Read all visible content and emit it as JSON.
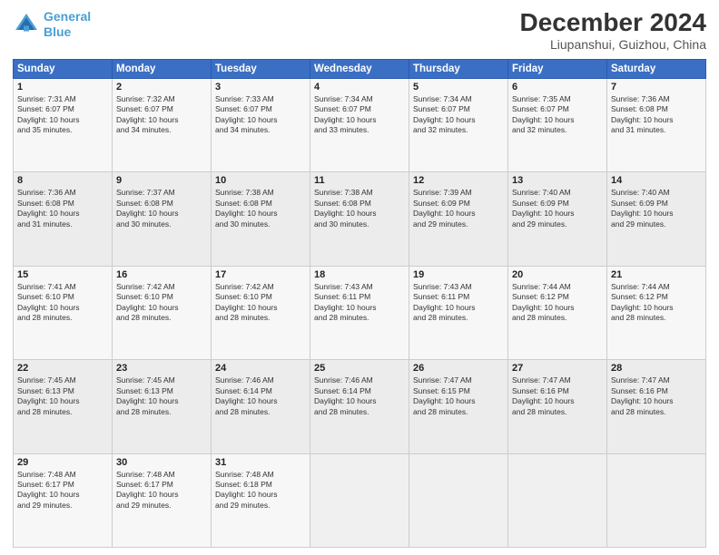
{
  "header": {
    "logo_line1": "General",
    "logo_line2": "Blue",
    "title": "December 2024",
    "subtitle": "Liupanshui, Guizhou, China"
  },
  "weekdays": [
    "Sunday",
    "Monday",
    "Tuesday",
    "Wednesday",
    "Thursday",
    "Friday",
    "Saturday"
  ],
  "weeks": [
    [
      {
        "day": "1",
        "lines": [
          "Sunrise: 7:31 AM",
          "Sunset: 6:07 PM",
          "Daylight: 10 hours",
          "and 35 minutes."
        ]
      },
      {
        "day": "2",
        "lines": [
          "Sunrise: 7:32 AM",
          "Sunset: 6:07 PM",
          "Daylight: 10 hours",
          "and 34 minutes."
        ]
      },
      {
        "day": "3",
        "lines": [
          "Sunrise: 7:33 AM",
          "Sunset: 6:07 PM",
          "Daylight: 10 hours",
          "and 34 minutes."
        ]
      },
      {
        "day": "4",
        "lines": [
          "Sunrise: 7:34 AM",
          "Sunset: 6:07 PM",
          "Daylight: 10 hours",
          "and 33 minutes."
        ]
      },
      {
        "day": "5",
        "lines": [
          "Sunrise: 7:34 AM",
          "Sunset: 6:07 PM",
          "Daylight: 10 hours",
          "and 32 minutes."
        ]
      },
      {
        "day": "6",
        "lines": [
          "Sunrise: 7:35 AM",
          "Sunset: 6:07 PM",
          "Daylight: 10 hours",
          "and 32 minutes."
        ]
      },
      {
        "day": "7",
        "lines": [
          "Sunrise: 7:36 AM",
          "Sunset: 6:08 PM",
          "Daylight: 10 hours",
          "and 31 minutes."
        ]
      }
    ],
    [
      {
        "day": "8",
        "lines": [
          "Sunrise: 7:36 AM",
          "Sunset: 6:08 PM",
          "Daylight: 10 hours",
          "and 31 minutes."
        ]
      },
      {
        "day": "9",
        "lines": [
          "Sunrise: 7:37 AM",
          "Sunset: 6:08 PM",
          "Daylight: 10 hours",
          "and 30 minutes."
        ]
      },
      {
        "day": "10",
        "lines": [
          "Sunrise: 7:38 AM",
          "Sunset: 6:08 PM",
          "Daylight: 10 hours",
          "and 30 minutes."
        ]
      },
      {
        "day": "11",
        "lines": [
          "Sunrise: 7:38 AM",
          "Sunset: 6:08 PM",
          "Daylight: 10 hours",
          "and 30 minutes."
        ]
      },
      {
        "day": "12",
        "lines": [
          "Sunrise: 7:39 AM",
          "Sunset: 6:09 PM",
          "Daylight: 10 hours",
          "and 29 minutes."
        ]
      },
      {
        "day": "13",
        "lines": [
          "Sunrise: 7:40 AM",
          "Sunset: 6:09 PM",
          "Daylight: 10 hours",
          "and 29 minutes."
        ]
      },
      {
        "day": "14",
        "lines": [
          "Sunrise: 7:40 AM",
          "Sunset: 6:09 PM",
          "Daylight: 10 hours",
          "and 29 minutes."
        ]
      }
    ],
    [
      {
        "day": "15",
        "lines": [
          "Sunrise: 7:41 AM",
          "Sunset: 6:10 PM",
          "Daylight: 10 hours",
          "and 28 minutes."
        ]
      },
      {
        "day": "16",
        "lines": [
          "Sunrise: 7:42 AM",
          "Sunset: 6:10 PM",
          "Daylight: 10 hours",
          "and 28 minutes."
        ]
      },
      {
        "day": "17",
        "lines": [
          "Sunrise: 7:42 AM",
          "Sunset: 6:10 PM",
          "Daylight: 10 hours",
          "and 28 minutes."
        ]
      },
      {
        "day": "18",
        "lines": [
          "Sunrise: 7:43 AM",
          "Sunset: 6:11 PM",
          "Daylight: 10 hours",
          "and 28 minutes."
        ]
      },
      {
        "day": "19",
        "lines": [
          "Sunrise: 7:43 AM",
          "Sunset: 6:11 PM",
          "Daylight: 10 hours",
          "and 28 minutes."
        ]
      },
      {
        "day": "20",
        "lines": [
          "Sunrise: 7:44 AM",
          "Sunset: 6:12 PM",
          "Daylight: 10 hours",
          "and 28 minutes."
        ]
      },
      {
        "day": "21",
        "lines": [
          "Sunrise: 7:44 AM",
          "Sunset: 6:12 PM",
          "Daylight: 10 hours",
          "and 28 minutes."
        ]
      }
    ],
    [
      {
        "day": "22",
        "lines": [
          "Sunrise: 7:45 AM",
          "Sunset: 6:13 PM",
          "Daylight: 10 hours",
          "and 28 minutes."
        ]
      },
      {
        "day": "23",
        "lines": [
          "Sunrise: 7:45 AM",
          "Sunset: 6:13 PM",
          "Daylight: 10 hours",
          "and 28 minutes."
        ]
      },
      {
        "day": "24",
        "lines": [
          "Sunrise: 7:46 AM",
          "Sunset: 6:14 PM",
          "Daylight: 10 hours",
          "and 28 minutes."
        ]
      },
      {
        "day": "25",
        "lines": [
          "Sunrise: 7:46 AM",
          "Sunset: 6:14 PM",
          "Daylight: 10 hours",
          "and 28 minutes."
        ]
      },
      {
        "day": "26",
        "lines": [
          "Sunrise: 7:47 AM",
          "Sunset: 6:15 PM",
          "Daylight: 10 hours",
          "and 28 minutes."
        ]
      },
      {
        "day": "27",
        "lines": [
          "Sunrise: 7:47 AM",
          "Sunset: 6:16 PM",
          "Daylight: 10 hours",
          "and 28 minutes."
        ]
      },
      {
        "day": "28",
        "lines": [
          "Sunrise: 7:47 AM",
          "Sunset: 6:16 PM",
          "Daylight: 10 hours",
          "and 28 minutes."
        ]
      }
    ],
    [
      {
        "day": "29",
        "lines": [
          "Sunrise: 7:48 AM",
          "Sunset: 6:17 PM",
          "Daylight: 10 hours",
          "and 29 minutes."
        ]
      },
      {
        "day": "30",
        "lines": [
          "Sunrise: 7:48 AM",
          "Sunset: 6:17 PM",
          "Daylight: 10 hours",
          "and 29 minutes."
        ]
      },
      {
        "day": "31",
        "lines": [
          "Sunrise: 7:48 AM",
          "Sunset: 6:18 PM",
          "Daylight: 10 hours",
          "and 29 minutes."
        ]
      },
      {
        "day": "",
        "lines": []
      },
      {
        "day": "",
        "lines": []
      },
      {
        "day": "",
        "lines": []
      },
      {
        "day": "",
        "lines": []
      }
    ]
  ]
}
